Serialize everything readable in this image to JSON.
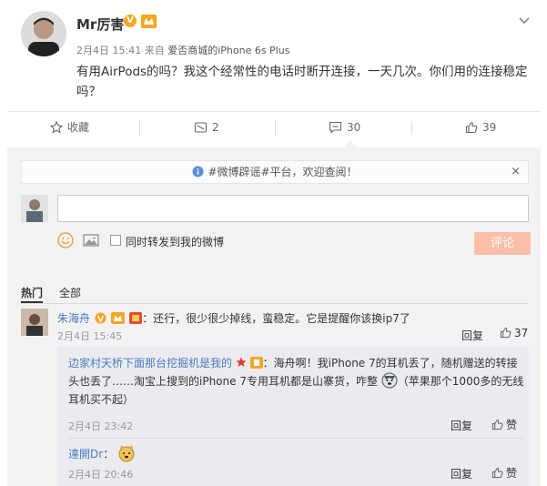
{
  "post": {
    "username": "Mr厉害",
    "verified_badge": "V",
    "meta_time": "2月4日 15:41",
    "meta_from": "来自",
    "meta_source": "爱否商城的iPhone 6s Plus",
    "content": "有用AirPods的吗？我这个经常性的电话时断开连接，一天几次。你们用的连接稳定吗？"
  },
  "actions": {
    "favorite_label": "收藏",
    "repost_count": "2",
    "comment_count": "30",
    "like_count": "39"
  },
  "comment_box": {
    "notice": "#微博辟谣#平台，欢迎查阅！",
    "notice_close": "×",
    "input_value": "",
    "repost_checkbox_label": "同时转发到我的微博",
    "submit_label": "评论"
  },
  "tabs": {
    "hot": "热门",
    "all": "全部"
  },
  "comments": [
    {
      "name": "朱海舟",
      "text": "：还行，很少很少掉线，蛮稳定。它是提醒你该换ip7了",
      "time": "2月4日 15:45",
      "reply_label": "回复",
      "like_count": "37",
      "replies": [
        {
          "name": "边家村天桥下面那台挖掘机是我的",
          "text_line1": "：海舟啊！我iPhone 7的耳机丢了，随机赠送的转接",
          "text_line2": "头也丢了……淘宝上搜到的iPhone 7专用耳机都是山寨货，咋整",
          "text_line2b": "（苹果那个1000多的无线",
          "text_line3": "耳机买不起）",
          "time": "2月4日 23:42",
          "reply_label": "回复",
          "like_label": "赞"
        },
        {
          "name": "達開Dr",
          "text": "：",
          "time": "2月4日 20:46",
          "reply_label": "回复",
          "like_label": "赞"
        }
      ]
    }
  ],
  "colors": {
    "accent": "#eb7350",
    "link": "#4a7bbf",
    "badge": "#f5a623",
    "button_disabled": "#fbbfa8"
  }
}
